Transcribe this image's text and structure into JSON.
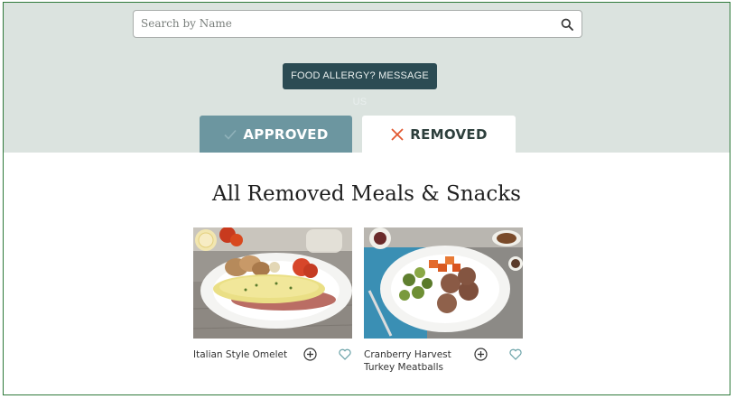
{
  "search": {
    "placeholder": "Search by Name",
    "icon": "search-icon"
  },
  "allergy_button": {
    "label": "FOOD ALLERGY? MESSAGE US"
  },
  "tabs": [
    {
      "label": "APPROVED",
      "icon": "check-icon",
      "active": false
    },
    {
      "label": "REMOVED",
      "icon": "close-icon",
      "active": true
    }
  ],
  "section_title": "All Removed Meals & Snacks",
  "meals": [
    {
      "name": "Italian Style Omelet",
      "add_icon": "plus-circle-icon",
      "fav_icon": "heart-icon"
    },
    {
      "name": "Cranberry Harvest Turkey Meatballs",
      "add_icon": "plus-circle-icon",
      "fav_icon": "heart-icon"
    }
  ],
  "colors": {
    "band": "#dbe3df",
    "allergy_button": "#2b4b53",
    "approved_tab": "#6c96a0",
    "removed_x": "#e2572f",
    "frame_border": "#2f7a3b"
  }
}
